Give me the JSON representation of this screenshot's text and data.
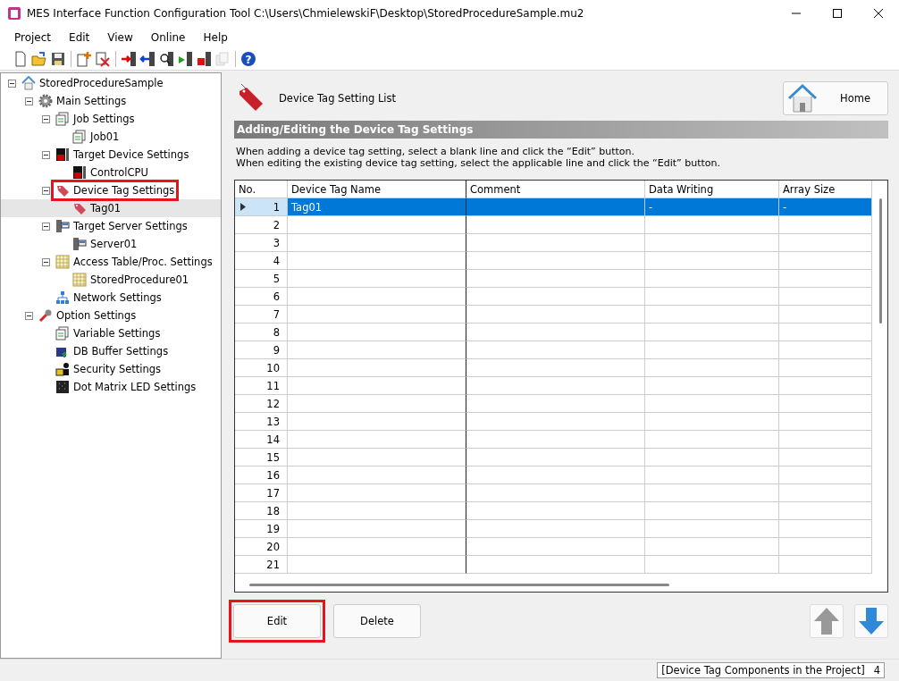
{
  "window": {
    "title": "MES Interface Function Configuration Tool C:\\Users\\ChmielewskiF\\Desktop\\StoredProcedureSample.mu2"
  },
  "menu": [
    "Project",
    "Edit",
    "View",
    "Online",
    "Help"
  ],
  "toolbar": [
    {
      "kind": "new"
    },
    {
      "kind": "open"
    },
    {
      "kind": "save"
    },
    {
      "kind": "sep"
    },
    {
      "kind": "add"
    },
    {
      "kind": "remove"
    },
    {
      "kind": "sep"
    },
    {
      "kind": "write"
    },
    {
      "kind": "read"
    },
    {
      "kind": "find"
    },
    {
      "kind": "run"
    },
    {
      "kind": "stop"
    },
    {
      "kind": "copy",
      "disabled": true
    },
    {
      "kind": "sep"
    },
    {
      "kind": "help",
      "label": "?"
    }
  ],
  "tree": [
    {
      "label": "StoredProcedureSample",
      "kind": "home",
      "expanded": true,
      "children": [
        {
          "label": "Main Settings",
          "kind": "gear",
          "expanded": true,
          "children": [
            {
              "label": "Job Settings",
              "kind": "job",
              "expanded": true,
              "children": [
                {
                  "label": "Job01",
                  "kind": "job"
                }
              ]
            },
            {
              "label": "Target Device Settings",
              "kind": "device",
              "expanded": true,
              "children": [
                {
                  "label": "ControlCPU",
                  "kind": "device"
                }
              ]
            },
            {
              "label": "Device Tag Settings",
              "kind": "tag",
              "expanded": true,
              "annotated": true,
              "children": [
                {
                  "label": "Tag01",
                  "kind": "tag",
                  "selected": true
                }
              ]
            },
            {
              "label": "Target Server Settings",
              "kind": "server",
              "expanded": true,
              "children": [
                {
                  "label": "Server01",
                  "kind": "server"
                }
              ]
            },
            {
              "label": "Access Table/Proc. Settings",
              "kind": "table",
              "expanded": true,
              "children": [
                {
                  "label": "StoredProcedure01",
                  "kind": "table"
                }
              ]
            },
            {
              "label": "Network Settings",
              "kind": "network"
            }
          ]
        },
        {
          "label": "Option Settings",
          "kind": "tools",
          "expanded": true,
          "children": [
            {
              "label": "Variable Settings",
              "kind": "job"
            },
            {
              "label": "DB Buffer Settings",
              "kind": "db"
            },
            {
              "label": "Security Settings",
              "kind": "lock"
            },
            {
              "label": "Dot Matrix LED Settings",
              "kind": "led"
            }
          ]
        }
      ]
    }
  ],
  "page": {
    "title": "Device Tag Setting List",
    "home_button": "Home",
    "section": "Adding/Editing the Device Tag Settings",
    "instructions": [
      "When adding a device tag setting, select a blank line and click the “Edit” button.",
      "When editing the existing device tag setting, select the applicable line and click the “Edit” button."
    ]
  },
  "table": {
    "columns": [
      "No.",
      "Device Tag Name",
      "Comment",
      "Data Writing",
      "Array Size"
    ],
    "rows": [
      {
        "no": "1",
        "name": "Tag01",
        "data_writing": "-",
        "array_size": "-",
        "selected": true
      },
      {
        "no": "2",
        "selected": false
      },
      {
        "no": "3",
        "selected": false
      },
      {
        "no": "4",
        "selected": false
      },
      {
        "no": "5",
        "selected": false
      },
      {
        "no": "6",
        "selected": false
      },
      {
        "no": "7",
        "selected": false
      },
      {
        "no": "8",
        "selected": false
      },
      {
        "no": "9",
        "selected": false
      },
      {
        "no": "10",
        "selected": false
      },
      {
        "no": "11",
        "selected": false
      },
      {
        "no": "12",
        "selected": false
      },
      {
        "no": "13",
        "selected": false
      },
      {
        "no": "14",
        "selected": false
      },
      {
        "no": "15",
        "selected": false
      },
      {
        "no": "16",
        "selected": false
      },
      {
        "no": "17",
        "selected": false
      },
      {
        "no": "18",
        "selected": false
      },
      {
        "no": "19",
        "selected": false
      },
      {
        "no": "20",
        "selected": false
      },
      {
        "no": "21",
        "selected": false
      }
    ]
  },
  "buttons": [
    {
      "label": "Edit",
      "annotated": true
    },
    {
      "label": "Delete",
      "annotated": false
    }
  ],
  "move_buttons": [
    {
      "kind": "up",
      "disabled": true
    },
    {
      "kind": "down",
      "disabled": false
    }
  ],
  "status_bar": {
    "label": "[Device Tag Components in the Project]",
    "count": "4"
  }
}
